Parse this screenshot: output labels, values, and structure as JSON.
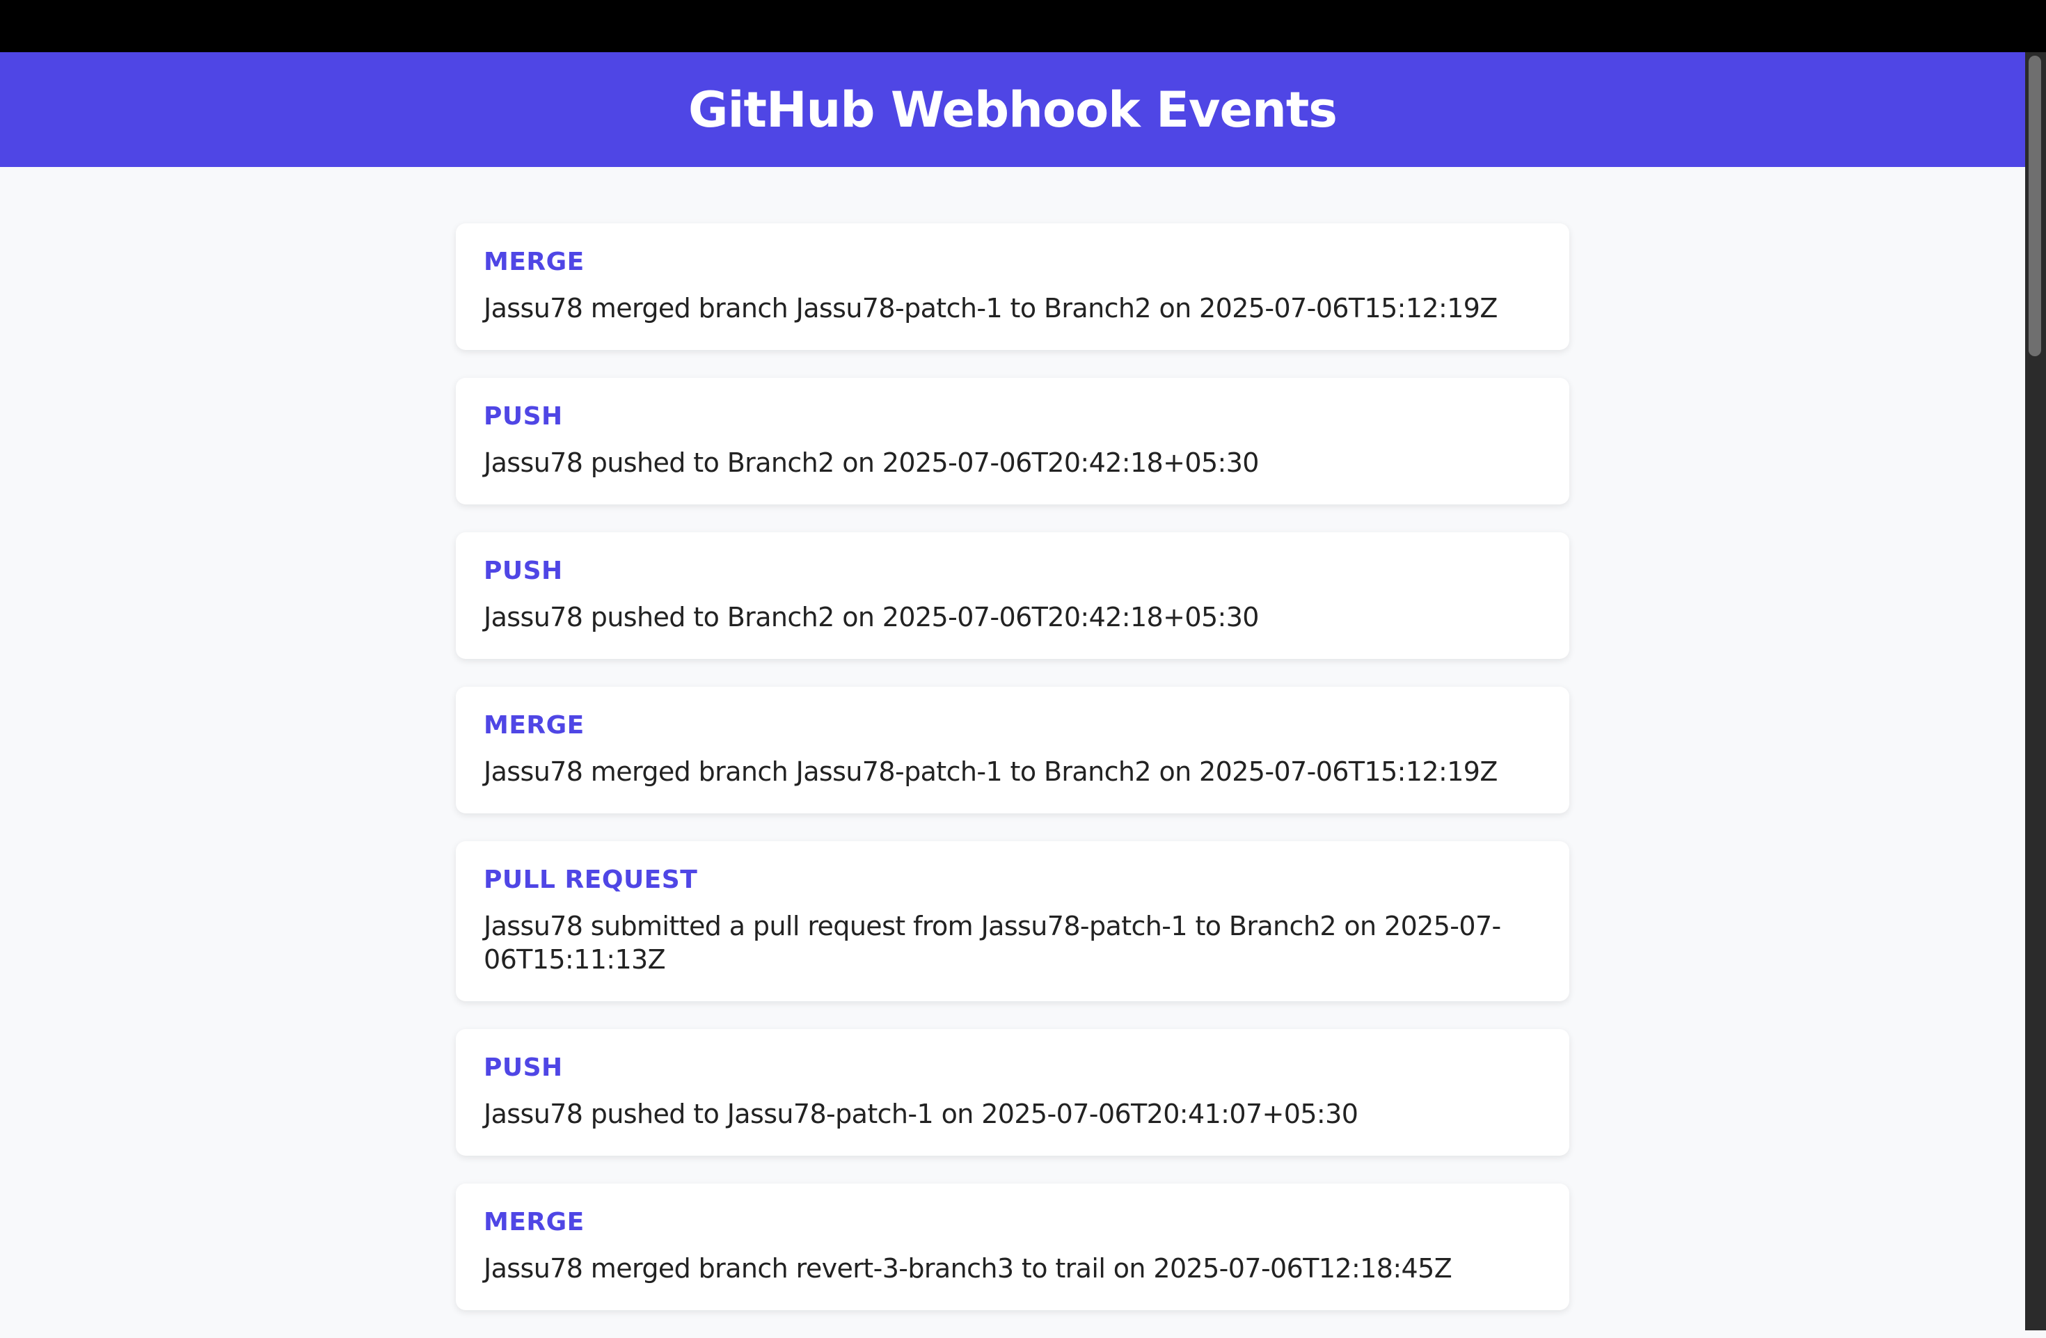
{
  "header": {
    "title": "GitHub Webhook Events"
  },
  "events": [
    {
      "type": "MERGE",
      "description": "Jassu78 merged branch Jassu78-patch-1 to Branch2 on 2025-07-06T15:12:19Z"
    },
    {
      "type": "PUSH",
      "description": "Jassu78 pushed to Branch2 on 2025-07-06T20:42:18+05:30"
    },
    {
      "type": "PUSH",
      "description": "Jassu78 pushed to Branch2 on 2025-07-06T20:42:18+05:30"
    },
    {
      "type": "MERGE",
      "description": "Jassu78 merged branch Jassu78-patch-1 to Branch2 on 2025-07-06T15:12:19Z"
    },
    {
      "type": "PULL REQUEST",
      "description": "Jassu78 submitted a pull request from Jassu78-patch-1 to Branch2 on 2025-07-06T15:11:13Z"
    },
    {
      "type": "PUSH",
      "description": "Jassu78 pushed to Jassu78-patch-1 on 2025-07-06T20:41:07+05:30"
    },
    {
      "type": "MERGE",
      "description": "Jassu78 merged branch revert-3-branch3 to trail on 2025-07-06T12:18:45Z"
    }
  ],
  "colors": {
    "accent": "#4f46e5",
    "page_background": "#f8f9fb",
    "card_background": "#ffffff",
    "text": "#222222"
  }
}
